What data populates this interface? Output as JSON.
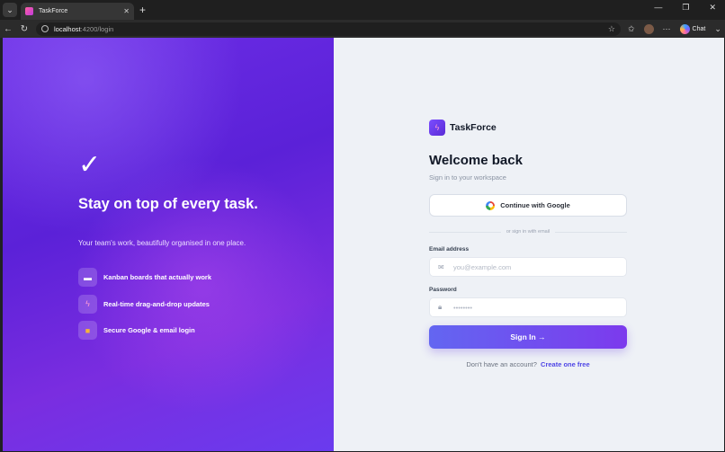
{
  "browser": {
    "tab_title": "TaskForce",
    "url_host": "localhost",
    "url_path": ":4200/login",
    "chat_label": "Chat"
  },
  "hero": {
    "title": "Stay on top of every task.",
    "subtitle": "Your team's work, beautifully organised in one place.",
    "features": [
      {
        "label": "Kanban boards that actually work"
      },
      {
        "label": "Real-time drag-and-drop updates"
      },
      {
        "label": "Secure Google & email login"
      }
    ]
  },
  "brand": {
    "name": "TaskForce"
  },
  "form": {
    "heading": "Welcome back",
    "subheading": "Sign in to your workspace",
    "google_label": "Continue with Google",
    "divider_text": "or sign in with email",
    "email_label": "Email address",
    "email_placeholder": "you@example.com",
    "password_label": "Password",
    "password_placeholder": "••••••••",
    "submit_label": "Sign In →",
    "signup_prompt": "Don't have an account?",
    "signup_link": "Create one free"
  },
  "colors": {
    "accent": "#6d28d9",
    "link": "#4f46e5",
    "form_bg": "#eef1f6"
  }
}
